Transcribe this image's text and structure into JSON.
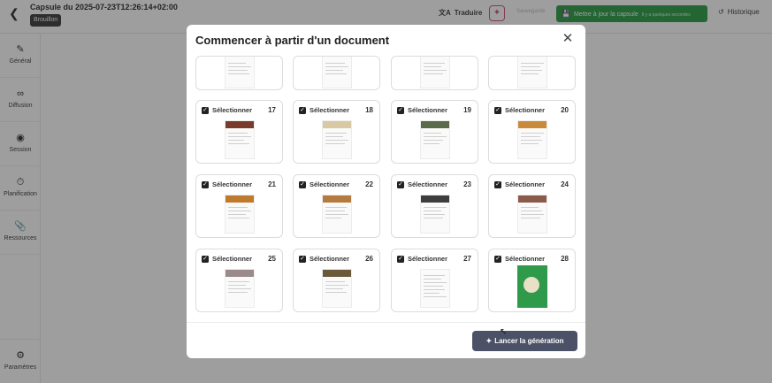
{
  "topbar": {
    "back_icon": "chevron-left-icon",
    "title": "Capsule du 2025-07-23T12:26:14+02:00",
    "status": "Brouillon",
    "translate_label": "Traduire",
    "autosave_text": "Sauvegardé",
    "update_label": "Mettre à jour la capsule",
    "update_sub": "Il y a quelques secondes",
    "history_label": "Historique"
  },
  "sidebar": {
    "items": [
      {
        "label": "Général",
        "icon": "brush-icon"
      },
      {
        "label": "Diffusion",
        "icon": "share-icon"
      },
      {
        "label": "Session",
        "icon": "record-icon"
      },
      {
        "label": "Planification",
        "icon": "timer-icon"
      },
      {
        "label": "Ressources",
        "icon": "paperclip-icon"
      }
    ],
    "settings_label": "Paramètres"
  },
  "modal": {
    "title": "Commencer à partir d'un document",
    "close_icon": "close-icon",
    "select_label": "Sélectionner",
    "pages": [
      17,
      18,
      19,
      20,
      21,
      22,
      23,
      24,
      25,
      26,
      27,
      28
    ],
    "launch_label": "Lancer la génération",
    "launch_icon": "magic-wand-icon"
  },
  "colors": {
    "accent_green": "#1f9a3f",
    "button_dark": "#4b5268",
    "overlay": "#282828",
    "magic_pink": "#d24a7a"
  }
}
